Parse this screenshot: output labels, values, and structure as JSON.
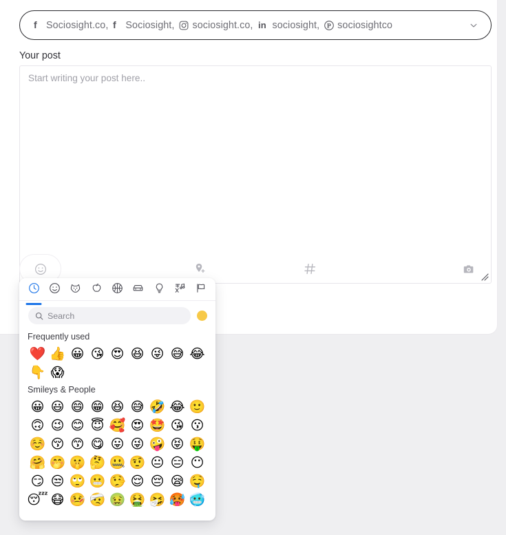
{
  "account_selector": {
    "accounts": [
      {
        "icon": "facebook-icon",
        "name": "Sociosight.co",
        "sep": ","
      },
      {
        "icon": "facebook-icon",
        "name": "Sociosight",
        "sep": ","
      },
      {
        "icon": "instagram-icon",
        "name": "sociosight.co",
        "sep": ","
      },
      {
        "icon": "linkedin-icon",
        "name": "sociosight",
        "sep": ","
      },
      {
        "icon": "pinterest-icon",
        "name": "sociosightco",
        "sep": ""
      }
    ],
    "chevron": "chevron-down-icon"
  },
  "editor": {
    "label": "Your post",
    "placeholder": "Start writing your post here..",
    "value": ""
  },
  "toolbar": {
    "items": [
      {
        "icon": "emoji-icon",
        "name": "emoji-picker-button"
      },
      {
        "icon": "location-pin-add-icon",
        "name": "add-location-button"
      },
      {
        "icon": "hashtag-icon",
        "name": "hashtag-button"
      },
      {
        "icon": "camera-icon",
        "name": "media-upload-button"
      }
    ]
  },
  "emoji_picker": {
    "tabs": [
      {
        "icon": "clock-icon",
        "label": "Frequently used",
        "active": true
      },
      {
        "icon": "smiley-icon",
        "label": "Smileys & People",
        "active": false
      },
      {
        "icon": "dog-icon",
        "label": "Animals & Nature",
        "active": false
      },
      {
        "icon": "apple-icon",
        "label": "Food & Drink",
        "active": false
      },
      {
        "icon": "basketball-icon",
        "label": "Activity",
        "active": false
      },
      {
        "icon": "car-icon",
        "label": "Travel & Places",
        "active": false
      },
      {
        "icon": "lightbulb-icon",
        "label": "Objects",
        "active": false
      },
      {
        "icon": "symbols-icon",
        "label": "Symbols",
        "active": false
      },
      {
        "icon": "flag-icon",
        "label": "Flags",
        "active": false
      }
    ],
    "search": {
      "placeholder": "Search",
      "value": "",
      "icon": "search-icon"
    },
    "skin_tone": {
      "name": "skin-tone-selector",
      "color": "#f7c948"
    },
    "sections": [
      {
        "title": "Frequently used",
        "emojis": [
          "❤️",
          "👍",
          "😀",
          "😘",
          "😍",
          "😆",
          "😜",
          "😅",
          "😂",
          "👇",
          "😱"
        ]
      },
      {
        "title": "Smileys & People",
        "emojis": [
          "😀",
          "😃",
          "😄",
          "😁",
          "😆",
          "😅",
          "🤣",
          "😂",
          "🙂",
          "🙃",
          "😉",
          "😊",
          "😇",
          "🥰",
          "😍",
          "🤩",
          "😘",
          "😗",
          "☺️",
          "😚",
          "😙",
          "😋",
          "😛",
          "😜",
          "🤪",
          "😝",
          "🤑",
          "🤗",
          "🤭",
          "🤫",
          "🤔",
          "🤐",
          "🤨",
          "😐",
          "😑",
          "😶",
          "😏",
          "😒",
          "🙄",
          "😬",
          "🤥",
          "😌",
          "😔",
          "😪",
          "🤤",
          "😴",
          "😷",
          "🤒",
          "🤕",
          "🤢",
          "🤮",
          "🤧",
          "🥵",
          "🥶"
        ]
      }
    ]
  },
  "colors": {
    "accent": "#1a73e8",
    "page_background": "#efeff1",
    "card_background": "#ffffff",
    "skin_tone": "#f7c948"
  }
}
